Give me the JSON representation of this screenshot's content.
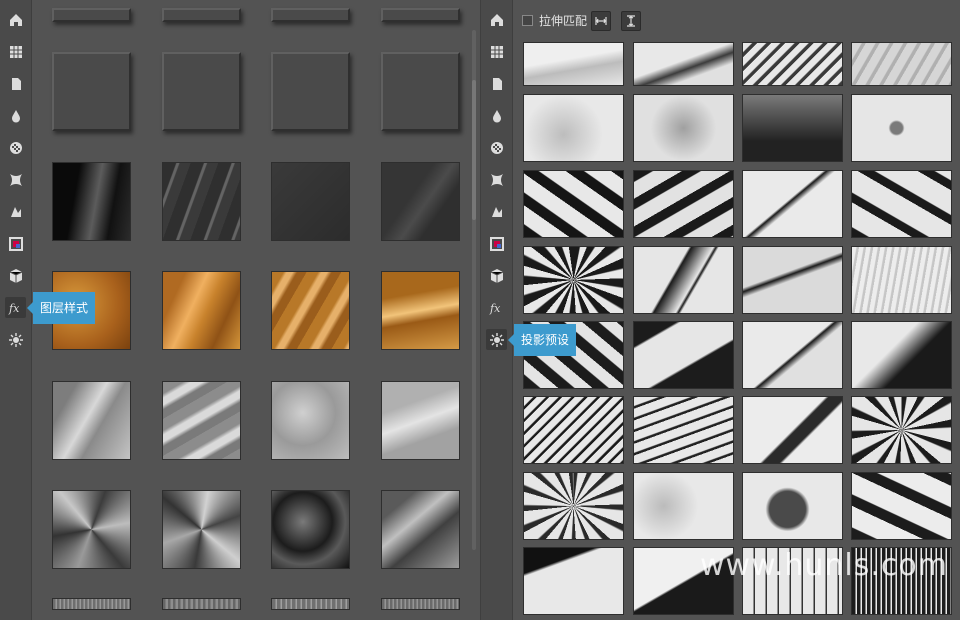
{
  "left_panel": {
    "tooltip": "图层样式",
    "toolbar_icons": [
      "home-icon",
      "grid-icon",
      "document-icon",
      "drop-icon",
      "checker-icon",
      "warp-icon",
      "shapes-icon",
      "color-frame-icon",
      "cube-icon",
      "fx-icon",
      "sun-icon"
    ],
    "styles": {
      "columns": 4,
      "rows": [
        {
          "kind": "bevel-top",
          "colors": [
            "#4b4b4b",
            "#4b4b4b",
            "#4b4b4b",
            "#4b4b4b"
          ]
        },
        {
          "kind": "bevel",
          "colors": [
            "#4a4a4a",
            "#4a4a4a",
            "#4a4a4a",
            "#4a4a4a"
          ]
        },
        {
          "kind": "dark",
          "colors": [
            "linear-gradient(100deg,#0a0a0a 30%,#5c5c5c 55%,#111 75%,#2b2b2b)",
            "repeating-linear-gradient(110deg,#2f2f2f 0 12px,#646464 13px 15px,#3a3a3a 16px 26px)",
            "linear-gradient(135deg,#3a3a3a,#2c2c2c)",
            "linear-gradient(125deg,#353535 40%,#4b4b4b 55%,#2f2f2f 70%)"
          ]
        },
        {
          "kind": "gold",
          "colors": [
            "radial-gradient(circle at 30% 40%,#d89a3c,#a9611c 60%,#7a410e)",
            "linear-gradient(115deg,#b06a22 20%,#f0b060 40%,#c8822c 55%,#8f5216 75%,#d5963a)",
            "repeating-linear-gradient(120deg,#b87828 0 10px,#e6b06a 13px 18px,#9a5d1c 22px 30px)",
            "linear-gradient(170deg,#a8681c 30%,#f2c47a 50%,#9a5a16 62%,#d49a46)"
          ]
        },
        {
          "kind": "silver",
          "colors": [
            "linear-gradient(120deg,#7d7d7d 20%,#d8d8d8 45%,#8a8a8a 60%,#c4c4c4)",
            "repeating-linear-gradient(150deg,#8c8c8c 0 10px,#dadada 14px 20px,#7a7a7a 24px 32px)",
            "radial-gradient(circle at 40% 40%,#d0d0d0,#9a9a9a 50%,#bdbdbd)",
            "linear-gradient(160deg,#b0b0b0 30%,#e4e4e4 50%,#a2a2a2 70%)"
          ]
        },
        {
          "kind": "metal",
          "colors": [
            "conic-gradient(from 20deg,#3c3c3c,#bdbdbd,#3a3a3a,#9a9a9a,#333,#c8c8c8,#3c3c3c)",
            "conic-gradient(from 70deg,#444,#cfcfcf,#3a3a3a,#a8a8a8,#333,#d2d2d2,#444)",
            "radial-gradient(circle at 40% 40%,#7a7a7a,#1c1c1c 45%,#5a5a5a 65%,#111)",
            "linear-gradient(140deg,#5a5a5a 20%,#c0c0c0 40%,#404040 60%,#9c9c9c)"
          ]
        },
        {
          "kind": "strip",
          "colors": [
            "repeating-linear-gradient(90deg,#6e6e6e 0 2px,#999 3px 4px)",
            "repeating-linear-gradient(90deg,#666 0 2px,#8e8e8e 3px 5px)",
            "repeating-linear-gradient(90deg,#707070 0 3px,#a0a0a0 4px 5px)",
            "repeating-linear-gradient(90deg,#6a6a6a 0 2px,#959595 3px 4px)"
          ]
        }
      ]
    }
  },
  "right_panel": {
    "tooltip": "投影预设",
    "stretch_label": "拉伸匹配",
    "stretch_checked": false,
    "buttons": [
      "fit-width-icon",
      "fit-height-icon"
    ],
    "shadows": {
      "columns": 4,
      "rows": [
        [
          "linear-gradient(170deg,#efefef 40%,#bcbcbc 60%,#e6e6e6)",
          "linear-gradient(160deg,#e8e8e8 45%,#3c3c3c 58%,#e0e0e0 72%)",
          "repeating-linear-gradient(135deg,#e8e8e8 0 6px,#3a3a3a 7px 10px)",
          "repeating-linear-gradient(120deg,#d6d6d6 0 8px,#b0b0b0 9px 12px)"
        ],
        [
          "radial-gradient(circle at 40% 60%,#bdbdbd,#e8e8e8 55%)",
          "radial-gradient(circle at 50% 50%,#a0a0a0,#e0e0e0 55%)",
          "linear-gradient(180deg,#7a7a7a,#222 70%)",
          "radial-gradient(circle at 45% 50%,#7a7a7a 0 6px,#e6e6e6 8px)"
        ],
        [
          "repeating-linear-gradient(35deg,#151515 0 10px,#e8e8e8 11px 26px)",
          "repeating-linear-gradient(150deg,#1a1a1a 0 9px,#e2e2e2 10px 24px)",
          "linear-gradient(140deg,#eaeaea 45%,#1a1a1a 47%,#eaeaea 52%)",
          "repeating-linear-gradient(30deg,#1a1a1a 0 8px,#e6e6e6 9px 30px)"
        ],
        [
          "repeating-conic-gradient(#1a1a1a 0 10deg,#e8e8e8 12deg 22deg)",
          "linear-gradient(120deg,#e6e6e6 40%,#1c1c1c 42%,#e6e6e6 58%,#1c1c1c 60%,#e6e6e6 62%)",
          "linear-gradient(160deg,#dadada 40%,#1c1c1c 44%,#dadada 50%)",
          "repeating-linear-gradient(100deg,#ededed 0 4px,#c6c6c6 5px 7px)"
        ],
        [
          "repeating-linear-gradient(40deg,#1c1c1c 0 10px,#e4e4e4 11px 22px)",
          "linear-gradient(150deg,#1c1c1c 20%,#e6e6e6 22%,#e6e6e6 60%,#1c1c1c 62%)",
          "linear-gradient(140deg,#eaeaea 50%,#1c1c1c 52%,#e0e0e0 58%)",
          "linear-gradient(135deg,#e8e8e8 40%,#1a1a1a 60%)"
        ],
        [
          "repeating-linear-gradient(135deg,#e8e8e8 0 6px,#1a1a1a 7px 9px)",
          "repeating-linear-gradient(160deg,#e8e8e8 0 8px,#222 9px 11px)",
          "linear-gradient(135deg,#ececec 50%,#2a2a2a 52%,#2a2a2a 62%,#ececec 64%)",
          "repeating-conic-gradient(#1c1c1c 0 8deg,#e6e6e6 10deg 26deg)"
        ],
        [
          "repeating-conic-gradient(#2a2a2a 0 6deg,#e6e6e6 8deg 22deg)",
          "radial-gradient(circle at 30% 50%,#bbbbbb,#e8e8e8 45%)",
          "radial-gradient(circle at 45% 55%,#4a4a4a 0 18px,#e8e8e8 22px)",
          "repeating-linear-gradient(25deg,#1c1c1c 0 10px,#ececec 11px 30px)"
        ],
        [
          "linear-gradient(160deg,#111 25%,#e8e8e8 28%)",
          "linear-gradient(150deg,#f0f0f0 50%,#1a1a1a 52%)",
          "repeating-linear-gradient(90deg,#e8e8e8 0 10px,#333 11px 12px)",
          "repeating-linear-gradient(90deg,#1c1c1c 0 3px,#e8e8e8 4px 5px)"
        ]
      ]
    }
  },
  "watermark": "www.hunls.com"
}
